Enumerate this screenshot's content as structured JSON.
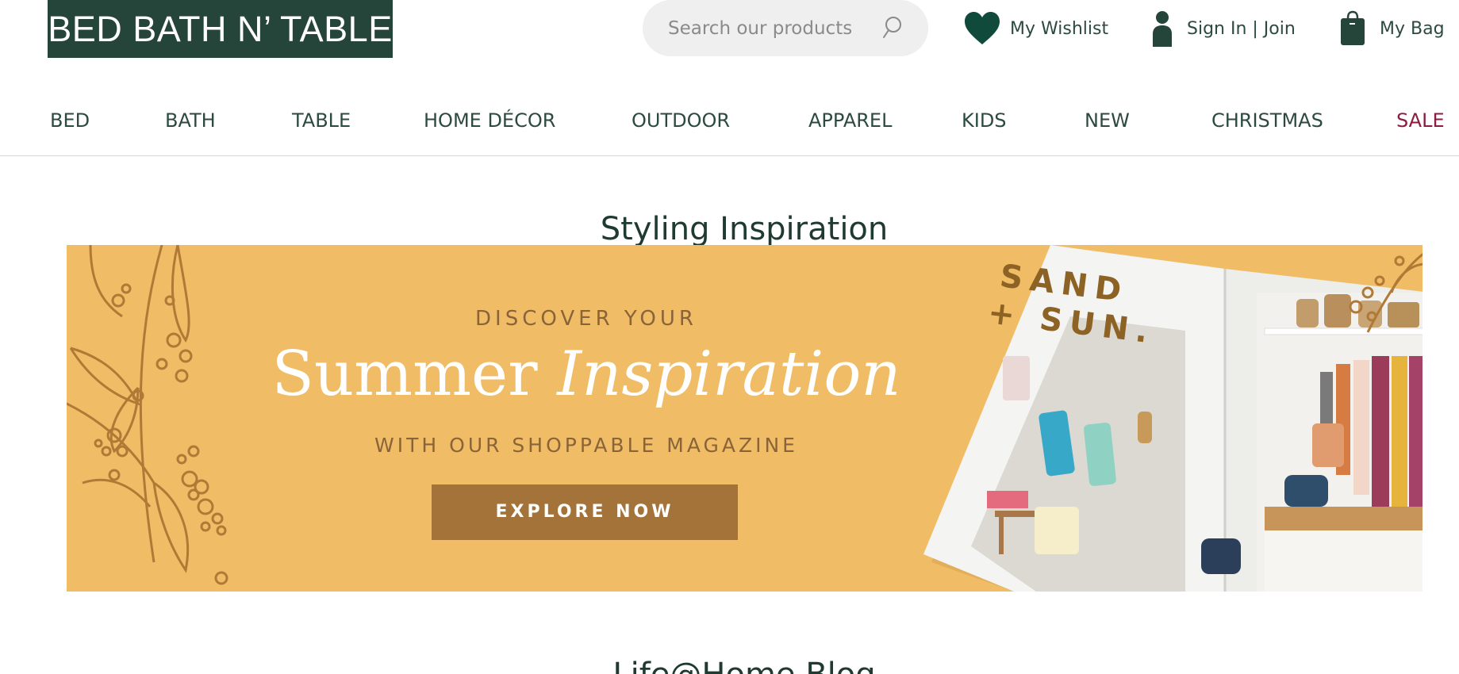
{
  "header": {
    "logo": "BED BATH N’ TABLE",
    "search": {
      "placeholder": "Search our products",
      "icon": "search-icon"
    },
    "wishlist": {
      "label": "My Wishlist",
      "icon": "heart-icon"
    },
    "account": {
      "label": "Sign In | Join",
      "icon": "user-icon"
    },
    "bag": {
      "label": "My Bag",
      "icon": "shopping-bag-icon"
    }
  },
  "nav": {
    "items": [
      {
        "label": "BED"
      },
      {
        "label": "BATH"
      },
      {
        "label": "TABLE"
      },
      {
        "label": "HOME DÉCOR"
      },
      {
        "label": "OUTDOOR"
      },
      {
        "label": "APPAREL"
      },
      {
        "label": "KIDS"
      },
      {
        "label": "NEW"
      },
      {
        "label": "CHRISTMAS"
      },
      {
        "label": "SALE"
      }
    ]
  },
  "main": {
    "section_title": "Styling Inspiration",
    "banner": {
      "line1": "DISCOVER YOUR",
      "headline_regular": "Summer",
      "headline_italic": "Inspiration",
      "line3": "WITH OUR SHOPPABLE MAGAZINE",
      "cta": "EXPLORE NOW",
      "magazine_line1": "SAND",
      "magazine_line2": "+ SUN."
    },
    "next_section_title": "Life@Home Blog"
  },
  "colors": {
    "brand": "#25443a",
    "text": "#2c4a3f",
    "sale": "#8c1d40",
    "banner_bg": "#f0bc66",
    "cta_bg": "#a4733a"
  }
}
